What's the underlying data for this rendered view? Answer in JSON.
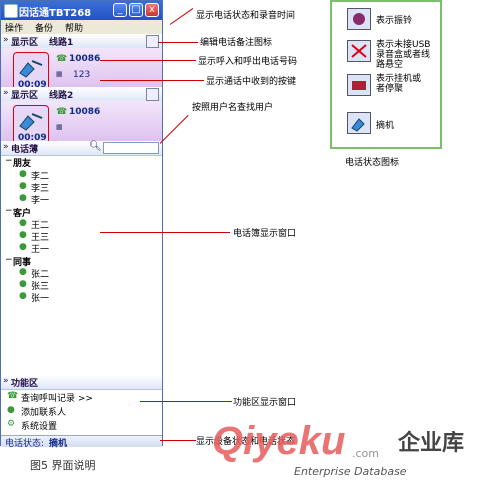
{
  "window": {
    "title": "因话通TBT268",
    "min_btn": "_",
    "max_btn": "□",
    "close_btn": "x",
    "menu": [
      "操作",
      "备份",
      "帮助"
    ]
  },
  "panels": [
    {
      "area": "显示区",
      "line": "线路1",
      "number": "10086",
      "digits": "123",
      "time": "00:09"
    },
    {
      "area": "显示区",
      "line": "线路2",
      "number": "10086",
      "time": "00:09"
    }
  ],
  "phonebook": {
    "title": "电话薄",
    "groups": [
      {
        "name": "朋友",
        "members": [
          "李二",
          "李三",
          "李一"
        ]
      },
      {
        "name": "客户",
        "members": [
          "王二",
          "王三",
          "王一"
        ]
      },
      {
        "name": "同事",
        "members": [
          "张二",
          "张三",
          "张一"
        ]
      }
    ]
  },
  "functions": {
    "title": "功能区",
    "items": [
      "查询呼叫记录 >>",
      "添加联系人",
      "系统设置"
    ]
  },
  "status": {
    "label": "电话状态:",
    "value": "摘机"
  },
  "annotations": {
    "status_time": "显示电话状态和录音时间",
    "edit_note": "编辑电话备注图标",
    "numbers": "显示呼入和呼出电话号码",
    "keys": "显示通话中收到的按键",
    "search": "按照用户名查找用户",
    "phonebook_window": "电话簿显示窗口",
    "func_window": "功能区显示窗口",
    "device_status": "显示设备状态和电话状态"
  },
  "legend": {
    "title": "电话状态图标",
    "items": [
      {
        "label": "表示振铃",
        "icon": "ringing-icon"
      },
      {
        "label": "表示未接USB录音盒或者线路悬空",
        "icon": "unplugged-icon"
      },
      {
        "label": "表示挂机或者停聚",
        "icon": "hangup-icon"
      },
      {
        "label": "摘机",
        "icon": "offhook-icon"
      }
    ]
  },
  "caption": "图5  界面说明",
  "watermark": {
    "brand": "Qiyeku",
    "domain": ".com",
    "cn": "企业库",
    "en": "Enterprise Database"
  }
}
